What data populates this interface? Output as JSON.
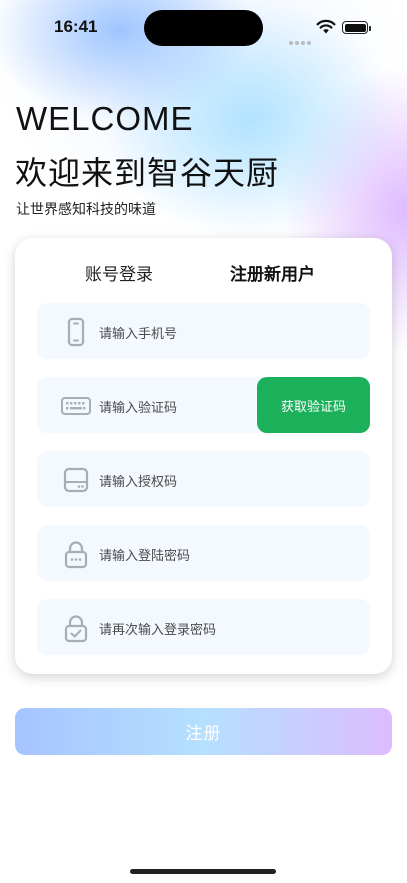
{
  "status_bar": {
    "time": "16:41"
  },
  "header": {
    "welcome": "WELCOME",
    "title": "欢迎来到智谷天厨",
    "subtitle": "让世界感知科技的味道"
  },
  "tabs": [
    {
      "label": "账号登录",
      "active": false
    },
    {
      "label": "注册新用户",
      "active": true
    }
  ],
  "form": {
    "phone_placeholder": "请输入手机号",
    "code_placeholder": "请输入验证码",
    "get_code_label": "获取验证码",
    "auth_placeholder": "请输入授权码",
    "password_placeholder": "请输入登陆密码",
    "confirm_placeholder": "请再次输入登录密码"
  },
  "register_label": "注册",
  "colors": {
    "accent_green": "#1bb05a",
    "icon_gray": "#a9adb5",
    "field_bg": "#f4f8ff"
  }
}
